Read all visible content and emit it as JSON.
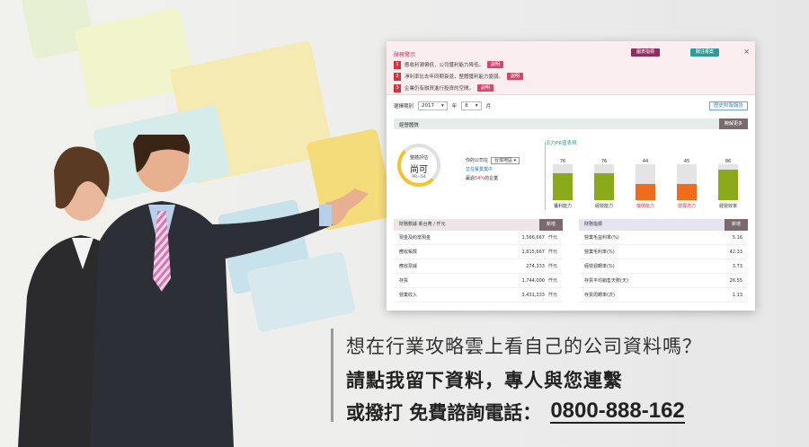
{
  "warning": {
    "title": "財務警示",
    "btn_industry": "圖表指標",
    "btn_follow": "關注專案",
    "close": "×",
    "items": [
      {
        "num": "1",
        "text": "應收利潤偏低，公司獲利能力降低。",
        "explain": "說明"
      },
      {
        "num": "2",
        "text": "淨利率比去年同期衰退，整體獲利能力變弱。",
        "explain": "說明"
      },
      {
        "num": "3",
        "text": "企業仍有融資進行投資的空間。",
        "explain": "說明"
      }
    ]
  },
  "period": {
    "label": "選擇期別",
    "year": "2017",
    "year_unit": "年",
    "month": "8",
    "month_unit": "月"
  },
  "history_button": "歷史財報報告",
  "overview": {
    "title": "經營體質",
    "more": "瞭解更多",
    "score_label": "整體評估",
    "score_value": "尚可",
    "score_pr": "PR=54",
    "compare_prefix": "你的公司在",
    "compare_region": "台灣地區",
    "compare_industry": "並在餐業業中",
    "compare_suffix_a": "贏過",
    "compare_pct": "54%",
    "compare_suffix_b": "的企業"
  },
  "pr_chart_title": "五力PR值表現",
  "chart_data": {
    "type": "bar",
    "categories": [
      "獲利能力",
      "經營能力",
      "償債能力",
      "發展潛力",
      "經營效率"
    ],
    "values": [
      76,
      76,
      44,
      45,
      86
    ],
    "ylim": [
      0,
      100
    ],
    "colors": [
      "#8aaa1a",
      "#8aaa1a",
      "#ee6c1c",
      "#ee6c1c",
      "#8aaa1a"
    ],
    "label_colors": [
      "#333333",
      "#333333",
      "#d2353d",
      "#d2353d",
      "#333333"
    ]
  },
  "table_left": {
    "title": "財務數據 新台幣 / 仟元",
    "add": "新增",
    "rows": [
      {
        "name": "現金及約當現金",
        "value": "1,566,667",
        "unit": "仟元"
      },
      {
        "name": "應收帳款",
        "value": "1,815,667",
        "unit": "仟元"
      },
      {
        "name": "應收票據",
        "value": "274,333",
        "unit": "仟元"
      },
      {
        "name": "存貨",
        "value": "1,744,000",
        "unit": "仟元"
      },
      {
        "name": "營業收入",
        "value": "3,431,333",
        "unit": "仟元"
      }
    ]
  },
  "table_right": {
    "title": "財務指標",
    "add": "新增",
    "rows": [
      {
        "name": "營業毛益利率(%)",
        "value": "5.16"
      },
      {
        "name": "營業毛利率(%)",
        "value": "42.33"
      },
      {
        "name": "經營週轉率(%)",
        "value": "3.73"
      },
      {
        "name": "存貨平均銷售天數(天)",
        "value": "26.55"
      },
      {
        "name": "存貨周轉率(次)",
        "value": "1.13"
      }
    ]
  },
  "cta": {
    "line1": "想在行業攻略雲上看自己的公司資料嗎？",
    "line2": "請點我留下資料，專人與您連繫",
    "line3_prefix": "或撥打  免費諮詢電話：",
    "phone": "0800-888-162"
  }
}
